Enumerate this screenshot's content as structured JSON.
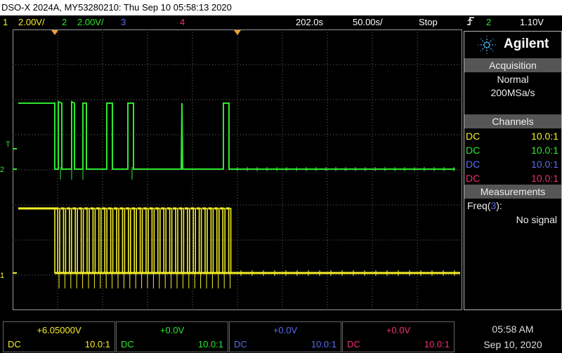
{
  "title": "DSO-X 2024A, MY53280210: Thu Sep 10 05:58:13 2020",
  "status": {
    "ch1_num": "1",
    "ch1_scale": "2.00V/",
    "ch2_num": "2",
    "ch2_scale": "2.00V/",
    "ch3_num": "3",
    "ch4_num": "4",
    "timebase_delay": "202.0s",
    "timebase_scale": "50.00s/",
    "run_state": "Stop",
    "trigger_icon": "trigger-edge-icon",
    "trigger_channel": "2",
    "trigger_level": "1.10V"
  },
  "brand": {
    "name": "Agilent",
    "logo_icon": "agilent-spark-icon"
  },
  "acquisition": {
    "header": "Acquisition",
    "mode": "Normal",
    "rate": "200MSa/s"
  },
  "channels": {
    "header": "Channels",
    "rows": [
      {
        "coupling": "DC",
        "probe": "10.0:1",
        "color": "#f5ef2a"
      },
      {
        "coupling": "DC",
        "probe": "10.0:1",
        "color": "#2ee82e"
      },
      {
        "coupling": "DC",
        "probe": "10.0:1",
        "color": "#5a6cf0"
      },
      {
        "coupling": "DC",
        "probe": "10.0:1",
        "color": "#f0306a"
      }
    ]
  },
  "measurements": {
    "header": "Measurements",
    "label_prefix": "Freq(",
    "label_channel": "3",
    "label_suffix": "):",
    "value": "No signal"
  },
  "bottom_channels": [
    {
      "offset": "+6.05000V",
      "coupling": "DC",
      "probe": "10.0:1",
      "color": "#f5ef2a"
    },
    {
      "offset": "+0.0V",
      "coupling": "DC",
      "probe": "10.0:1",
      "color": "#2ee82e"
    },
    {
      "offset": "+0.0V",
      "coupling": "DC",
      "probe": "10.0:1",
      "color": "#5a6cf0"
    },
    {
      "offset": "+0.0V",
      "coupling": "DC",
      "probe": "10.0:1",
      "color": "#f0306a"
    }
  ],
  "clock": {
    "time": "05:58 AM",
    "date": "Sep 10, 2020"
  },
  "markers": {
    "trigger_mark": "T",
    "ch2_mark": "2",
    "ch1_mark": "1"
  },
  "colors": {
    "ch1": "#f5ef2a",
    "ch2": "#2ee82e",
    "ch3": "#5a6cf0",
    "ch4": "#f0306a",
    "trigger_marker": "#f0a030"
  }
}
